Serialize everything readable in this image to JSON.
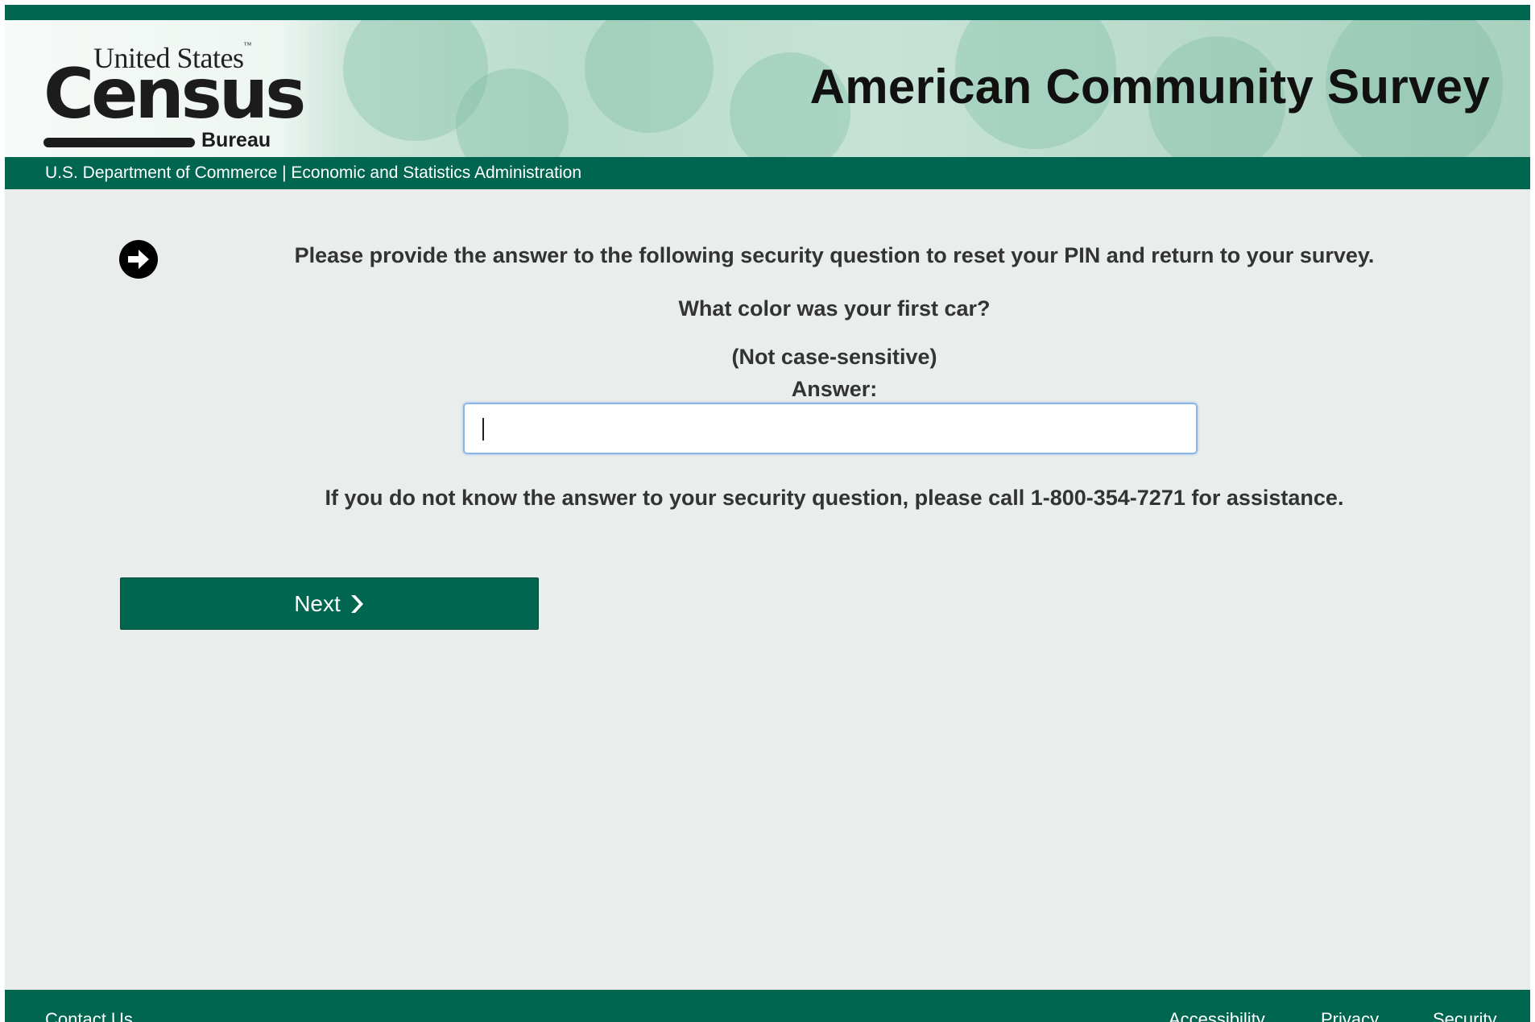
{
  "header": {
    "logo": {
      "line1": "United States",
      "tm": "™",
      "line2": "Census",
      "line3": "Bureau"
    },
    "title": "American Community Survey",
    "dept_text": "U.S. Department of Commerce  |  Economic and Statistics Administration"
  },
  "main": {
    "instruction_icon": "arrow-right-circle-icon",
    "instruction": "Please provide the answer to the following security question to reset your PIN and return to your survey.",
    "question": "What color was your first car?",
    "case_note": "(Not case-sensitive)",
    "answer_label": "Answer:",
    "answer_value": "",
    "help_text": "If you do not know the answer to your security question, please call 1-800-354-7271 for assistance.",
    "next_label": "Next",
    "next_icon": "chevron-right-icon"
  },
  "footer": {
    "contact": "Contact Us",
    "accessibility": "Accessibility",
    "privacy": "Privacy",
    "security": "Security"
  },
  "colors": {
    "brand_green": "#00664f",
    "page_background": "#e9eeec",
    "input_focus_border": "#8fb5e8"
  }
}
